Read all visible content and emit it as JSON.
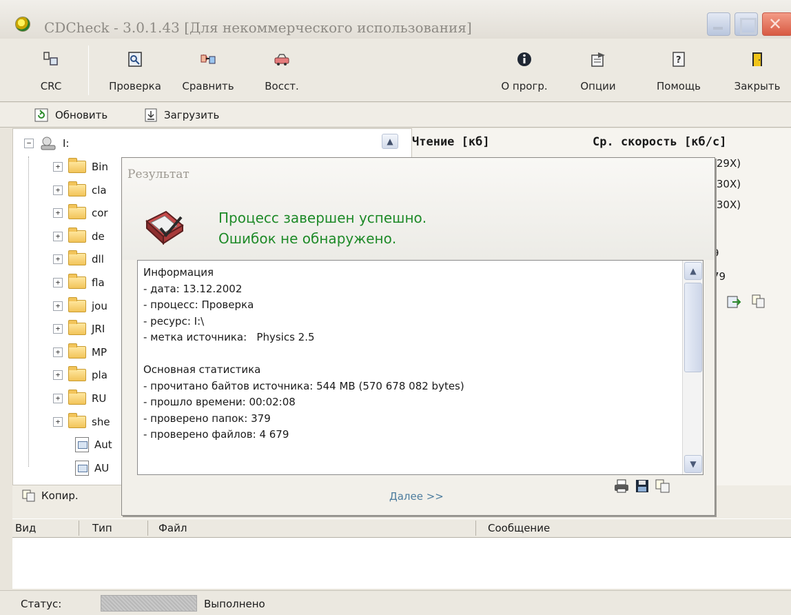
{
  "window": {
    "title": "CDCheck - 3.0.1.43 [Для некоммерческого использования]"
  },
  "toolbar": {
    "crc": "CRC",
    "check": "Проверка",
    "compare": "Сравнить",
    "restore": "Восст.",
    "about": "О прогр.",
    "options": "Опции",
    "help": "Помощь",
    "close": "Закрыть"
  },
  "subbar": {
    "refresh": "Обновить",
    "load": "Загрузить"
  },
  "tree": {
    "root": "I:",
    "items": [
      "Bin",
      "cla",
      "cor",
      "de",
      "dll",
      "fla",
      "jou",
      "JRI",
      "MP",
      "pla",
      "RU",
      "she",
      "Aut",
      "AU"
    ]
  },
  "right": {
    "read_header": "Чтение [кб]",
    "speed_header": "Ср. скорость [кб/с]",
    "speeds": [
      "(29X)",
      "(30X)",
      "(30X)"
    ],
    "partial_a": "9",
    "partial_b": "79"
  },
  "bottom": {
    "copy_tab": "Копир.",
    "col_kind": "Вид",
    "col_type": "Тип",
    "col_file": "Файл",
    "col_message": "Сообщение"
  },
  "status": {
    "label": "Статус:",
    "text": "Выполнено"
  },
  "dialog": {
    "title": "Результат",
    "message_line1": "Процесс завершен успешно.",
    "message_line2": "Ошибок не обнаружено.",
    "info_text": "Информация\n- дата: 13.12.2002\n- процесс: Проверка\n- ресурс: I:\\\n- метка источника:   Physics 2.5\n\nОсновная статистика\n- прочитано байтов источника: 544 MB (570 678 082 bytes)\n- прошло времени: 00:02:08\n- проверено папок: 379\n- проверено файлов: 4 679",
    "next": "Далее >>"
  },
  "colors": {
    "success": "#1e8a28",
    "link": "#4c7c9e"
  }
}
